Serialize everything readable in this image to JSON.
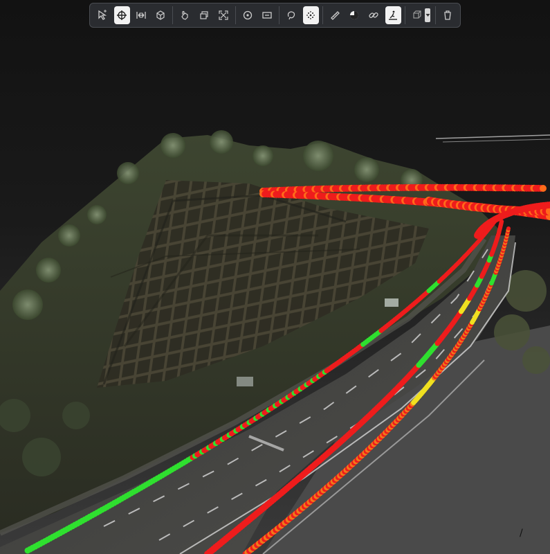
{
  "viewer": {
    "corner_mark": "/"
  },
  "toolbar": {
    "groups": [
      [
        {
          "name": "select-tool",
          "icon": "select-arrow-icon",
          "active": false
        },
        {
          "name": "orbit-tool",
          "icon": "orbit-crosshair-icon",
          "active": true
        },
        {
          "name": "fit-width-tool",
          "icon": "fit-width-icon",
          "active": false
        },
        {
          "name": "box-view-tool",
          "icon": "cube-icon",
          "active": false
        }
      ],
      [
        {
          "name": "pan-tool",
          "icon": "hand-pointer-icon",
          "active": false
        },
        {
          "name": "layers-tool",
          "icon": "layers-icon",
          "active": false
        },
        {
          "name": "fullscreen-tool",
          "icon": "expand-icon",
          "active": false
        }
      ],
      [
        {
          "name": "point-tool",
          "icon": "target-point-icon",
          "active": false
        },
        {
          "name": "label-tool",
          "icon": "label-box-icon",
          "active": false
        }
      ],
      [
        {
          "name": "lasso-tool",
          "icon": "lasso-icon",
          "active": false
        },
        {
          "name": "point-cloud-tool",
          "icon": "point-cloud-icon",
          "active": true
        }
      ],
      [
        {
          "name": "measure-tool",
          "icon": "ruler-icon",
          "active": false
        },
        {
          "name": "color-mode-tool",
          "icon": "half-circle-icon",
          "active": false
        },
        {
          "name": "link-tool",
          "icon": "link-icon",
          "active": false
        },
        {
          "name": "path-tool",
          "icon": "path-person-icon",
          "active": true
        }
      ],
      [
        {
          "name": "view-cube-tool",
          "icon": "view-cube-icon",
          "active": false,
          "has_caret": true
        }
      ],
      [
        {
          "name": "delete-tool",
          "icon": "trash-icon",
          "active": false
        }
      ]
    ]
  },
  "colors": {
    "track_red": "#ee1c1c",
    "track_green": "#2fe02f",
    "track_yellow": "#f0e020",
    "vegetation": "#5a6a3a",
    "road": "#4a4a48",
    "lane_marking": "#d8d8d8"
  }
}
